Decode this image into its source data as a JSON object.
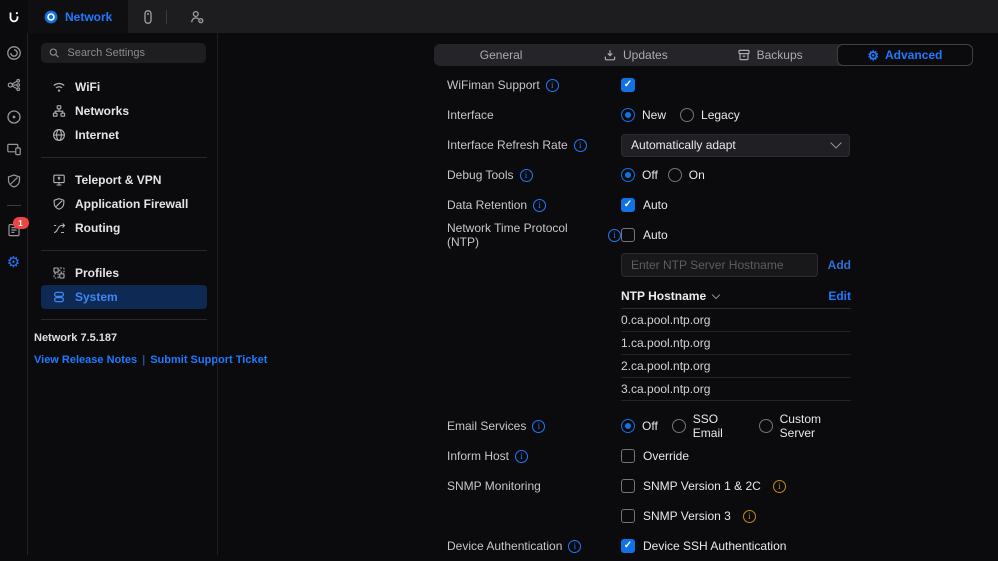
{
  "topbar": {
    "app_name": "Network"
  },
  "rail": {
    "badge_count": "1"
  },
  "sidebar": {
    "search_placeholder": "Search Settings",
    "group1": [
      {
        "label": "WiFi"
      },
      {
        "label": "Networks"
      },
      {
        "label": "Internet"
      }
    ],
    "group2": [
      {
        "label": "Teleport & VPN"
      },
      {
        "label": "Application Firewall"
      },
      {
        "label": "Routing"
      }
    ],
    "group3": [
      {
        "label": "Profiles"
      },
      {
        "label": "System"
      }
    ],
    "active_item": "System",
    "footer": {
      "version": "Network 7.5.187",
      "release_notes": "View Release Notes",
      "separator": "|",
      "support": "Submit Support Ticket"
    }
  },
  "tabs": [
    {
      "label": "General"
    },
    {
      "label": "Updates"
    },
    {
      "label": "Backups"
    },
    {
      "label": "Advanced"
    }
  ],
  "active_tab": "Advanced",
  "settings": {
    "wifiman": {
      "label": "WiFiman Support",
      "checked": true
    },
    "interface": {
      "label": "Interface",
      "options": [
        "New",
        "Legacy"
      ],
      "selected": "New"
    },
    "refresh_rate": {
      "label": "Interface Refresh Rate",
      "value": "Automatically adapt"
    },
    "debug_tools": {
      "label": "Debug Tools",
      "options": [
        "Off",
        "On"
      ],
      "selected": "Off"
    },
    "data_retention": {
      "label": "Data Retention",
      "checkbox_label": "Auto",
      "checked": true
    },
    "ntp": {
      "label": "Network Time Protocol (NTP)",
      "checkbox_label": "Auto",
      "checked": false,
      "input_placeholder": "Enter NTP Server Hostname",
      "add_label": "Add",
      "table": {
        "header": "NTP Hostname",
        "edit_label": "Edit",
        "rows": [
          "0.ca.pool.ntp.org",
          "1.ca.pool.ntp.org",
          "2.ca.pool.ntp.org",
          "3.ca.pool.ntp.org"
        ]
      }
    },
    "email_services": {
      "label": "Email Services",
      "options": [
        "Off",
        "SSO Email",
        "Custom Server"
      ],
      "selected": "Off"
    },
    "inform_host": {
      "label": "Inform Host",
      "checkbox_label": "Override",
      "checked": false
    },
    "snmp": {
      "label": "SNMP Monitoring",
      "options": [
        "SNMP Version 1 & 2C",
        "SNMP Version 3"
      ]
    },
    "device_auth": {
      "label": "Device Authentication",
      "checkbox_label": "Device SSH Authentication",
      "checked": true
    }
  },
  "colors": {
    "accent": "#2079ff",
    "control_blue": "#1172e6",
    "warning_info": "#bf8c1a",
    "badge_red": "#ee4444",
    "active_nav_bg": "#0e2a54"
  }
}
